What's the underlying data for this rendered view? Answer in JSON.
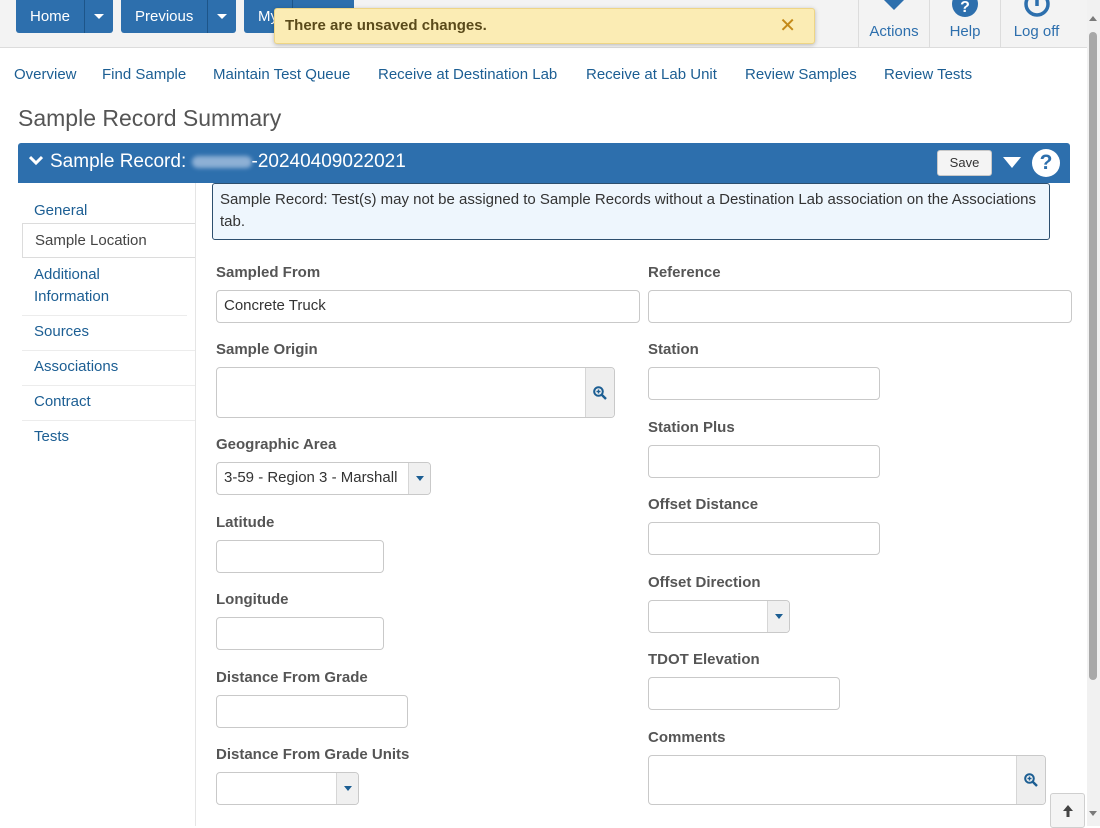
{
  "topbar": {
    "home_label": "Home",
    "previous_label": "Previous",
    "my_label": "My",
    "toast_message": "There are unsaved changes.",
    "toast_close": "✕",
    "actions_label": "Actions",
    "help_label": "Help",
    "logoff_label": "Log off"
  },
  "nav": {
    "items": [
      "Overview",
      "Find Sample",
      "Maintain Test Queue",
      "Receive at Destination Lab",
      "Receive at Lab Unit",
      "Review Samples",
      "Review Tests"
    ]
  },
  "page": {
    "title": "Sample Record Summary"
  },
  "panel": {
    "title_prefix": "Sample Record: ",
    "title_suffix": "-20240409022021",
    "save_label": "Save",
    "help_symbol": "?"
  },
  "sidebar": {
    "items": [
      "General",
      "Sample Location",
      "Additional Information",
      "Sources",
      "Associations",
      "Contract",
      "Tests"
    ],
    "active_index": 1
  },
  "info": {
    "message": "Sample Record: Test(s) may not be assigned to Sample Records without a Destination Lab association on the Associations tab."
  },
  "form": {
    "left": {
      "sampled_from_label": "Sampled From",
      "sampled_from_value": "Concrete Truck",
      "sample_origin_label": "Sample Origin",
      "sample_origin_value": "",
      "geographic_area_label": "Geographic Area",
      "geographic_area_value": "3-59 - Region 3 - Marshall",
      "latitude_label": "Latitude",
      "latitude_value": "",
      "longitude_label": "Longitude",
      "longitude_value": "",
      "distance_from_grade_label": "Distance From Grade",
      "distance_from_grade_value": "",
      "distance_units_label": "Distance From Grade Units",
      "distance_units_value": ""
    },
    "right": {
      "reference_label": "Reference",
      "reference_value": "",
      "station_label": "Station",
      "station_value": "",
      "station_plus_label": "Station Plus",
      "station_plus_value": "",
      "offset_distance_label": "Offset Distance",
      "offset_distance_value": "",
      "offset_direction_label": "Offset Direction",
      "offset_direction_value": "",
      "tdot_elevation_label": "TDOT Elevation",
      "tdot_elevation_value": "",
      "comments_label": "Comments",
      "comments_value": ""
    }
  },
  "colors": {
    "primary": "#2d6fad",
    "link": "#1c5e93",
    "toast_bg": "#fbecb4",
    "info_bg": "#eef6fd"
  }
}
